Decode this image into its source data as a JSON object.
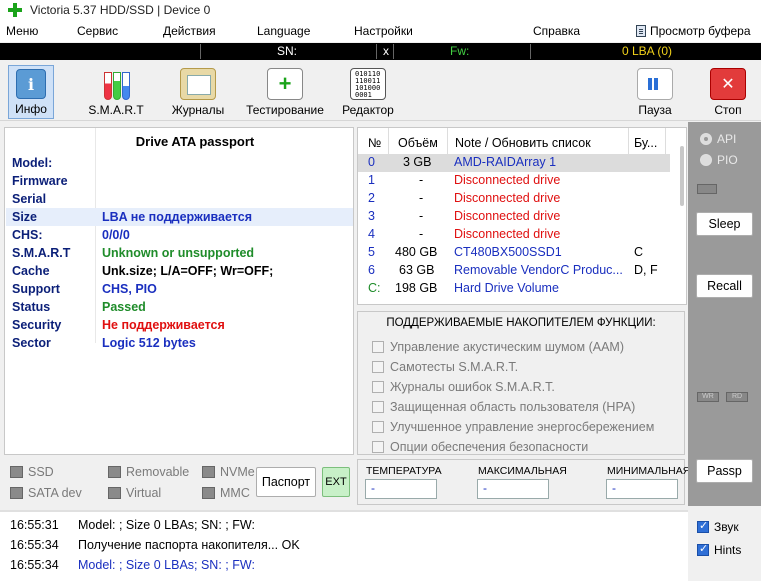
{
  "title": "Victoria 5.37 HDD/SSD | Device 0",
  "menu": {
    "items": [
      "Меню",
      "Сервис",
      "Действия",
      "Language",
      "Настройки",
      "Справка"
    ],
    "clipboard": "Просмотр буфера"
  },
  "infostrip": {
    "sn_label": "SN:",
    "x": "x",
    "fw_label": "Fw:",
    "lba": "0 LBA (0)"
  },
  "toolbar": {
    "info": "Инфо",
    "smart": "S.M.A.R.T",
    "journals": "Журналы",
    "testing": "Тестирование",
    "editor": "Редактор",
    "pause": "Пауза",
    "stop": "Стоп",
    "editor_icon_text": "010110\n110011\n101000\n0001"
  },
  "passport": {
    "heading": "Drive ATA passport",
    "rows": [
      {
        "k": "Model:",
        "v": ""
      },
      {
        "k": "Firmware",
        "v": ""
      },
      {
        "k": "Serial",
        "v": ""
      },
      {
        "k": "Size",
        "v": "LBA не поддерживается"
      },
      {
        "k": "CHS:",
        "v": "0/0/0"
      },
      {
        "k": "S.M.A.R.T",
        "v": "Unknown or unsupported"
      },
      {
        "k": "Cache",
        "v": "Unk.size; L/A=OFF; Wr=OFF;"
      },
      {
        "k": "Support",
        "v": "CHS, PIO"
      },
      {
        "k": "Status",
        "v": "Passed"
      },
      {
        "k": "Security",
        "v": "Не поддерживается"
      },
      {
        "k": "Sector",
        "v": "Logic 512 bytes"
      }
    ]
  },
  "drives": {
    "headers": [
      "№",
      "Объём",
      "Note / Обновить список",
      "Бу..."
    ],
    "rows": [
      {
        "n": "0",
        "size": "3 GB",
        "note": "AMD-RAIDArray 1",
        "bu": ""
      },
      {
        "n": "1",
        "size": "-",
        "note": "Disconnected drive",
        "bu": ""
      },
      {
        "n": "2",
        "size": "-",
        "note": "Disconnected drive",
        "bu": ""
      },
      {
        "n": "3",
        "size": "-",
        "note": "Disconnected drive",
        "bu": ""
      },
      {
        "n": "4",
        "size": "-",
        "note": "Disconnected drive",
        "bu": ""
      },
      {
        "n": "5",
        "size": "480 GB",
        "note": "CT480BX500SSD1",
        "bu": "C"
      },
      {
        "n": "6",
        "size": "63 GB",
        "note": "Removable VendorC Produc...",
        "bu": "D, F"
      },
      {
        "n": "C:",
        "size": "198 GB",
        "note": "Hard Drive Volume",
        "bu": ""
      }
    ]
  },
  "features": {
    "heading": "ПОДДЕРЖИВАЕМЫЕ НАКОПИТЕЛЕМ ФУНКЦИИ:",
    "items": [
      "Управление акустическим шумом (AAM)",
      "Самотесты S.M.A.R.T.",
      "Журналы ошибок S.M.A.R.T.",
      "Защищенная область пользователя (HPA)",
      "Улучшенное управление энергосбережением",
      "Опции обеспечения безопасности"
    ]
  },
  "temps": {
    "labels": [
      "ТЕМПЕРАТУРА",
      "МАКСИМАЛЬНАЯ",
      "МИНИМАЛЬНАЯ"
    ],
    "values": [
      "-",
      "-",
      "-"
    ]
  },
  "types": {
    "ssd": "SSD",
    "removable": "Removable",
    "nvme": "NVMe",
    "satadev": "SATA dev",
    "virtual": "Virtual",
    "mmc": "MMC",
    "passport_btn": "Паспорт",
    "ext_btn": "EXT"
  },
  "side": {
    "api": "API",
    "pio": "PIO",
    "sleep": "Sleep",
    "recall": "Recall",
    "wr": "WR",
    "rd": "RD",
    "passp": "Passp"
  },
  "log": [
    {
      "t": "16:55:31",
      "msg": "Model:  ; Size 0 LBAs; SN:  ; FW:"
    },
    {
      "t": "16:55:34",
      "msg": "Получение паспорта накопителя... OK"
    },
    {
      "t": "16:55:34",
      "msg": "Model:  ; Size 0 LBAs; SN:  ; FW:"
    }
  ],
  "logopts": {
    "sound": "Звук",
    "hints": "Hints"
  },
  "colors": {
    "accent": "#2f6fd6",
    "disconnected": "#e01010",
    "label_blue": "#0b1f78",
    "panel_gray": "#9a9a9a"
  }
}
